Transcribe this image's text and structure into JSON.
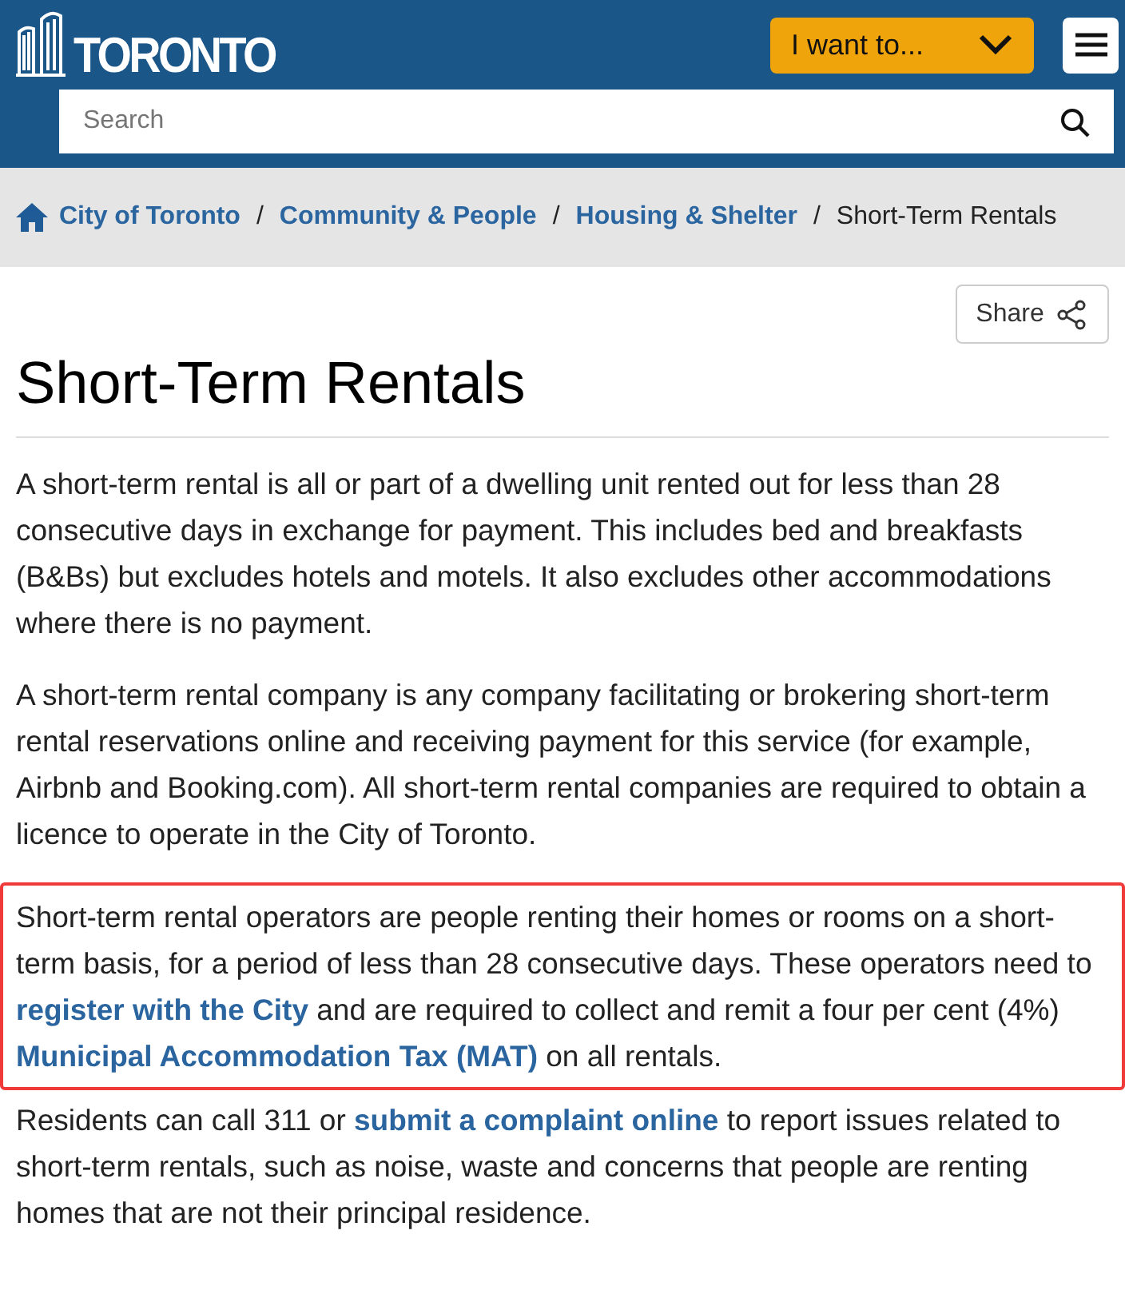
{
  "header": {
    "logo_text": "TORONTO",
    "menu_button": "I want to...",
    "search": {
      "placeholder": "Search"
    }
  },
  "breadcrumb_separator": "/",
  "breadcrumb": [
    {
      "label": "City of Toronto",
      "kind": "link"
    },
    {
      "label": "Community & People",
      "kind": "link"
    },
    {
      "label": "Housing & Shelter",
      "kind": "link"
    },
    {
      "label": "Short-Term Rentals",
      "kind": "current"
    }
  ],
  "share_button": "Share",
  "title": "Short-Term Rentals",
  "paragraphs": [
    {
      "highlighted": false,
      "segments": [
        {
          "kind": "text",
          "text": "A short-term rental is all or part of a dwelling unit rented out for less than 28 consecutive days in exchange for payment. This includes bed and breakfasts (B&Bs) but excludes hotels and motels. It also excludes other accommodations where there is no payment."
        }
      ]
    },
    {
      "highlighted": false,
      "segments": [
        {
          "kind": "text",
          "text": "A short-term rental company is any company facilitating or brokering short-term rental reservations online and receiving payment for this service (for example, Airbnb and Booking.com). All short-term rental companies are required to obtain a licence to operate in the City of Toronto."
        }
      ]
    },
    {
      "highlighted": true,
      "segments": [
        {
          "kind": "text",
          "text": "Short-term rental operators are people renting their homes or rooms on a short-term basis, for a period of less than 28 consecutive days. These operators need to "
        },
        {
          "kind": "link",
          "text": "register with the City"
        },
        {
          "kind": "text",
          "text": " and are required to collect and remit a four per cent (4%) "
        },
        {
          "kind": "link",
          "text": "Municipal Accommodation Tax (MAT)"
        },
        {
          "kind": "text",
          "text": " on all rentals."
        }
      ]
    },
    {
      "highlighted": false,
      "segments": [
        {
          "kind": "text",
          "text": "Residents can call 311 or "
        },
        {
          "kind": "link",
          "text": "submit a complaint online"
        },
        {
          "kind": "text",
          "text": " to report issues related to short-term rentals, such as noise, waste and concerns that people are renting homes that are not their principal residence."
        }
      ]
    }
  ]
}
